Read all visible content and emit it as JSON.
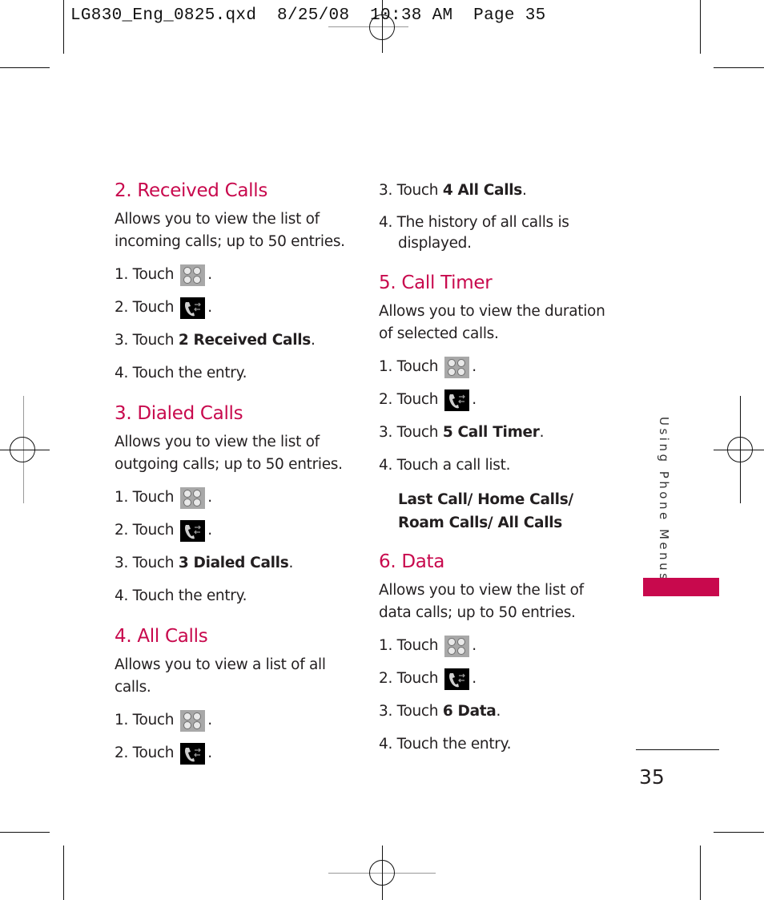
{
  "slug": "LG830_Eng_0825.qxd  8/25/08  10:38 AM  Page 35",
  "colors": {
    "accent": "#c8094d",
    "text": "#231f20"
  },
  "icons": {
    "menu": "menu-grid-icon",
    "call_history": "call-history-icon"
  },
  "sections": [
    {
      "title": "2. Received Calls",
      "description": "Allows you to view the list of incoming calls; up to 50 entries.",
      "steps": [
        {
          "prefix": "1. Touch",
          "icon": "menu-grid-icon",
          "suffix": "."
        },
        {
          "prefix": "2. Touch",
          "icon": "call-history-icon",
          "suffix": "."
        },
        {
          "prefix": "3. Touch ",
          "bold": "2 Received Calls",
          "suffix": "."
        },
        {
          "prefix": "4. Touch the entry."
        }
      ]
    },
    {
      "title": "3. Dialed Calls",
      "description": "Allows you to view the list of outgoing calls; up to 50 entries.",
      "steps": [
        {
          "prefix": "1. Touch",
          "icon": "menu-grid-icon",
          "suffix": "."
        },
        {
          "prefix": "2. Touch",
          "icon": "call-history-icon",
          "suffix": "."
        },
        {
          "prefix": "3. Touch ",
          "bold": "3 Dialed Calls",
          "suffix": "."
        },
        {
          "prefix": "4. Touch the entry."
        }
      ]
    },
    {
      "title": "4. All Calls",
      "description": "Allows you to view a list of all calls.",
      "steps": [
        {
          "prefix": "1. Touch",
          "icon": "menu-grid-icon",
          "suffix": "."
        },
        {
          "prefix": "2. Touch",
          "icon": "call-history-icon",
          "suffix": "."
        },
        {
          "prefix": "3. Touch ",
          "bold": "4 All Calls",
          "suffix": "."
        },
        {
          "prefix": "4. The history of all calls is displayed."
        }
      ]
    },
    {
      "title": "5. Call Timer",
      "description": "Allows you to view the duration of selected calls.",
      "steps": [
        {
          "prefix": "1. Touch",
          "icon": "menu-grid-icon",
          "suffix": "."
        },
        {
          "prefix": "2. Touch",
          "icon": "call-history-icon",
          "suffix": "."
        },
        {
          "prefix": "3. Touch ",
          "bold": "5 Call Timer",
          "suffix": "."
        },
        {
          "prefix": "4. Touch a call list."
        }
      ],
      "options": "Last Call/ Home Calls/ Roam Calls/ All Calls"
    },
    {
      "title": "6. Data",
      "description": "Allows you to view the list of data calls; up to 50 entries.",
      "steps": [
        {
          "prefix": "1. Touch",
          "icon": "menu-grid-icon",
          "suffix": "."
        },
        {
          "prefix": "2. Touch",
          "icon": "call-history-icon",
          "suffix": "."
        },
        {
          "prefix": "3. Touch ",
          "bold": "6 Data",
          "suffix": "."
        },
        {
          "prefix": "4. Touch the entry."
        }
      ]
    }
  ],
  "side_tab": "Using Phone Menus",
  "page_number": "35"
}
